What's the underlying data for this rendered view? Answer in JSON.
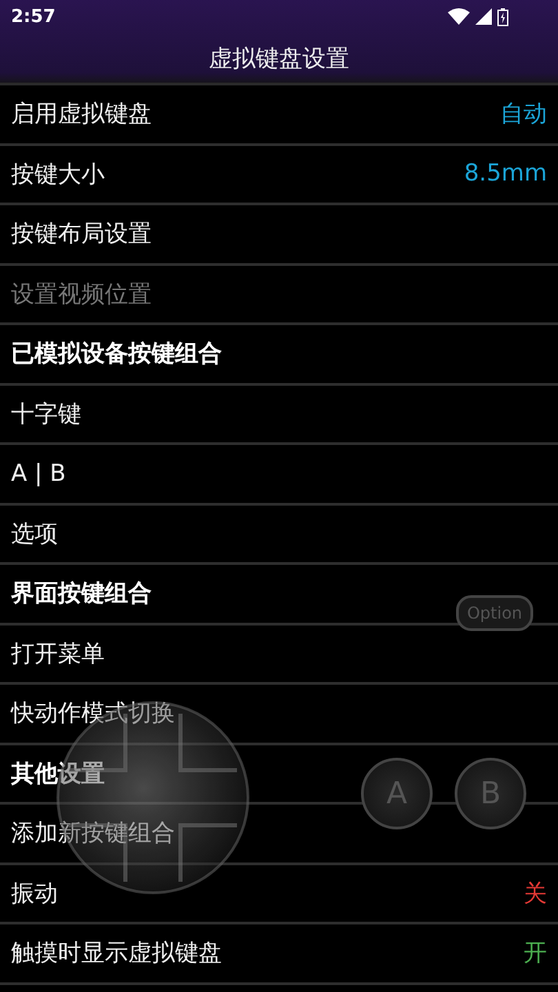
{
  "status_bar": {
    "time": "2:57"
  },
  "title": "虚拟键盘设置",
  "items": [
    {
      "kind": "item",
      "label": "启用虚拟键盘",
      "value": "自动",
      "color": "#1ba5d8",
      "disabled": false
    },
    {
      "kind": "item",
      "label": "按键大小",
      "value": "8.5mm",
      "color": "#1ba5d8",
      "disabled": false
    },
    {
      "kind": "item",
      "label": "按键布局设置",
      "disabled": false
    },
    {
      "kind": "item",
      "label": "设置视频位置",
      "disabled": true
    },
    {
      "kind": "header",
      "label": "已模拟设备按键组合"
    },
    {
      "kind": "item",
      "label": "十字键",
      "disabled": false
    },
    {
      "kind": "item",
      "label": "A | B",
      "disabled": false
    },
    {
      "kind": "item",
      "label": "选项",
      "disabled": false
    },
    {
      "kind": "header",
      "label": "界面按键组合"
    },
    {
      "kind": "item",
      "label": "打开菜单",
      "disabled": false
    },
    {
      "kind": "item",
      "label": "快动作模式切换",
      "disabled": false
    },
    {
      "kind": "header",
      "label": "其他设置"
    },
    {
      "kind": "item",
      "label": "添加新按键组合",
      "disabled": false
    },
    {
      "kind": "item",
      "label": "振动",
      "value": "关",
      "color": "#e53935",
      "disabled": false
    },
    {
      "kind": "item",
      "label": "触摸时显示虚拟键盘",
      "value": "开",
      "color": "#4caf50",
      "disabled": false
    }
  ],
  "overlay": {
    "option": "Option",
    "buttons": [
      "A",
      "B"
    ]
  }
}
